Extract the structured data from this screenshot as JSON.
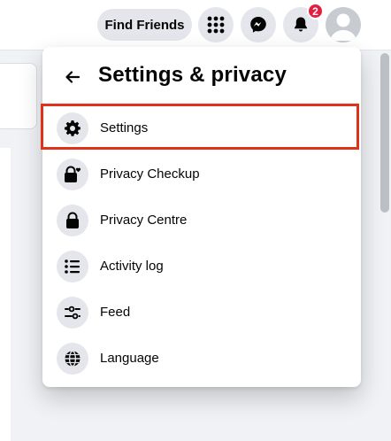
{
  "topbar": {
    "find_friends_label": "Find Friends",
    "notifications_badge": "2"
  },
  "panel": {
    "title": "Settings & privacy",
    "items": [
      {
        "label": "Settings",
        "icon": "gear-icon"
      },
      {
        "label": "Privacy Checkup",
        "icon": "lock-heart-icon"
      },
      {
        "label": "Privacy Centre",
        "icon": "lock-icon"
      },
      {
        "label": "Activity log",
        "icon": "list-icon"
      },
      {
        "label": "Feed",
        "icon": "sliders-icon"
      },
      {
        "label": "Language",
        "icon": "globe-icon"
      }
    ]
  },
  "colors": {
    "highlight": "#e0321b",
    "badge": "#e41e3f",
    "icon_bg": "#e4e6eb"
  }
}
